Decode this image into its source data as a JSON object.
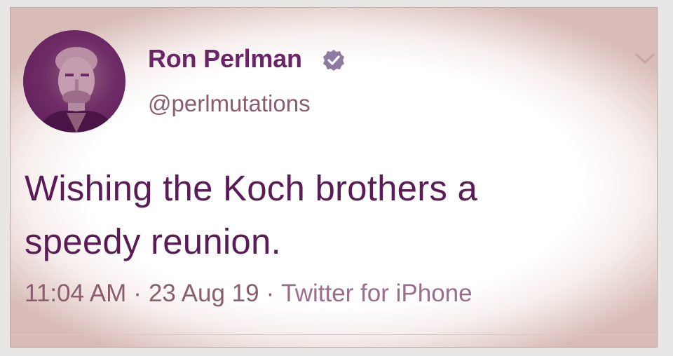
{
  "tweet": {
    "author_name": "Ron Perlman",
    "handle": "@perlmutations",
    "text_line1": "Wishing the Koch brothers a",
    "text_line2": "speedy reunion.",
    "time": "11:04 AM",
    "date": "23 Aug 19",
    "source": "Twitter for iPhone",
    "separator": "·"
  },
  "icons": {
    "verified": "verified-badge-icon",
    "chevron": "chevron-down-icon",
    "avatar": "profile-avatar"
  },
  "colors": {
    "accent": "#6b2466",
    "text": "#5a1b57",
    "muted": "#8a5e6d"
  }
}
